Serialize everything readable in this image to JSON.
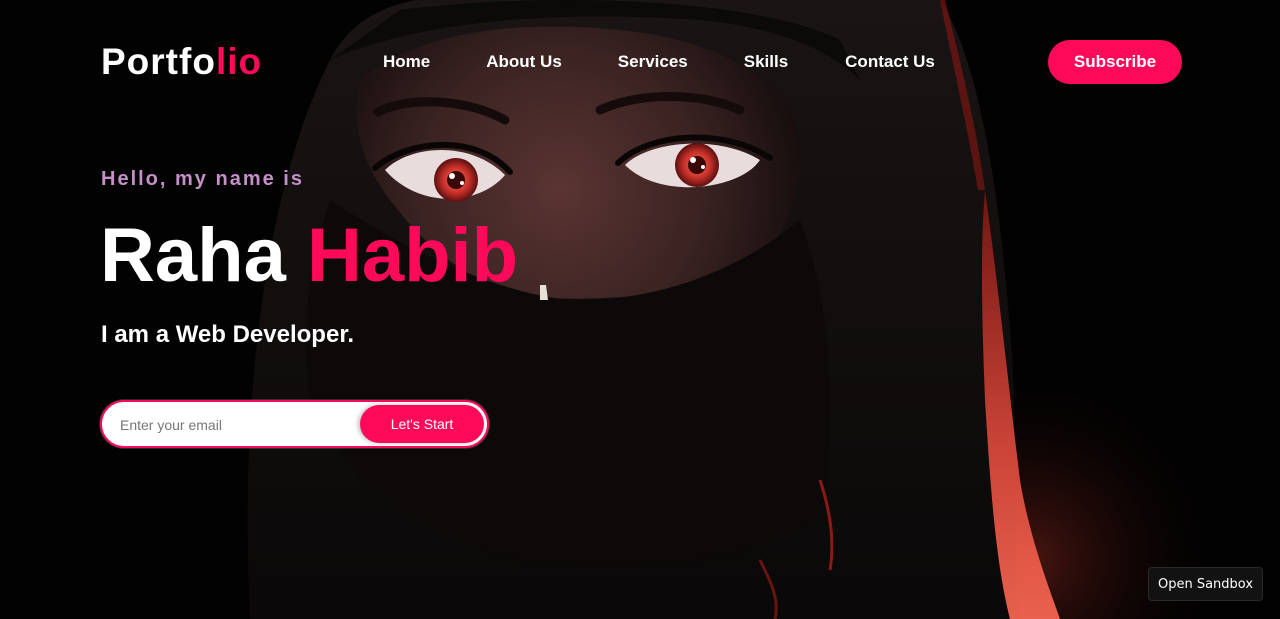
{
  "header": {
    "logo_main": "Portfo",
    "logo_accent": "lio",
    "nav": [
      "Home",
      "About Us",
      "Services",
      "Skills",
      "Contact Us"
    ],
    "subscribe_label": "Subscribe"
  },
  "hero": {
    "greeting": "Hello, my name is",
    "first_name": "Raha",
    "last_name": "Habib",
    "tagline": "I am a Web Developer.",
    "email_placeholder": "Enter your email",
    "email_value": "",
    "cta_label": "Let's Start"
  },
  "sandbox": {
    "label": "Open Sandbox"
  },
  "colors": {
    "accent": "#ff0a5a",
    "greeting": "#c58fc8",
    "background": "#020202",
    "text": "#ffffff"
  },
  "background_image": "anime-girl-in-black-hijab-with-red-eyes"
}
